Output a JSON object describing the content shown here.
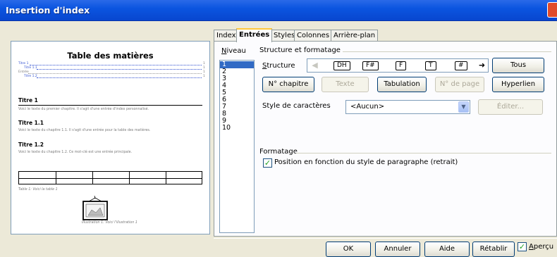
{
  "window": {
    "title": "Insertion d'index"
  },
  "preview": {
    "heading": "Table des matières",
    "toc": [
      {
        "text": "Titre 1",
        "page": "1",
        "style": "link"
      },
      {
        "text": "Titre 1.1",
        "page": "1",
        "style": "link"
      },
      {
        "text": "Entrée",
        "page": "1",
        "style": "plain"
      },
      {
        "text": "Titre 1.2",
        "page": "1",
        "style": "link"
      }
    ],
    "sections": [
      {
        "title": "Titre 1",
        "body": "Voici le texte du premier chapitre. Il s'agit d'une entrée d'index personnalisé."
      },
      {
        "title": "Titre 1.1",
        "body": "Voici le texte du chapitre 1.1. Il s'agit d'une entrée pour la table des matières."
      },
      {
        "title": "Titre 1.2",
        "body": "Voici le texte du chapitre 1.2. Ce mot-clé est une entrée principale."
      }
    ],
    "table_caption": "Table 1: Voici la table 1",
    "illustration_caption": "Illustration 1: Voici l'illustration 1"
  },
  "tabs": [
    "Index",
    "Entrées",
    "Styles",
    "Colonnes",
    "Arrière-plan"
  ],
  "active_tab": "Entrées",
  "level": {
    "label": "Niveau",
    "items": [
      "1",
      "2",
      "3",
      "4",
      "5",
      "6",
      "7",
      "8",
      "9",
      "10"
    ],
    "selected": "1"
  },
  "structure_section": {
    "title": "Structure et formatage",
    "structure_label": "Structure",
    "tokens": [
      "DH",
      "F#",
      "F",
      "T",
      "#"
    ],
    "all_button": "Tous"
  },
  "buttons": {
    "chapter_no": "N° chapitre",
    "text": "Texte",
    "tabulation": "Tabulation",
    "page_no": "N° de page",
    "hyperlink": "Hyperlien",
    "edit": "Éditer..."
  },
  "char_style": {
    "label": "Style de caractères",
    "value": "<Aucun>"
  },
  "format_section": {
    "title": "Formatage",
    "position_label": "Position en fonction du style de paragraphe (retrait)",
    "position_checked": true
  },
  "footer": {
    "ok": "OK",
    "cancel": "Annuler",
    "help": "Aide",
    "reset": "Rétablir",
    "preview_label": "Aperçu",
    "preview_checked": true
  }
}
